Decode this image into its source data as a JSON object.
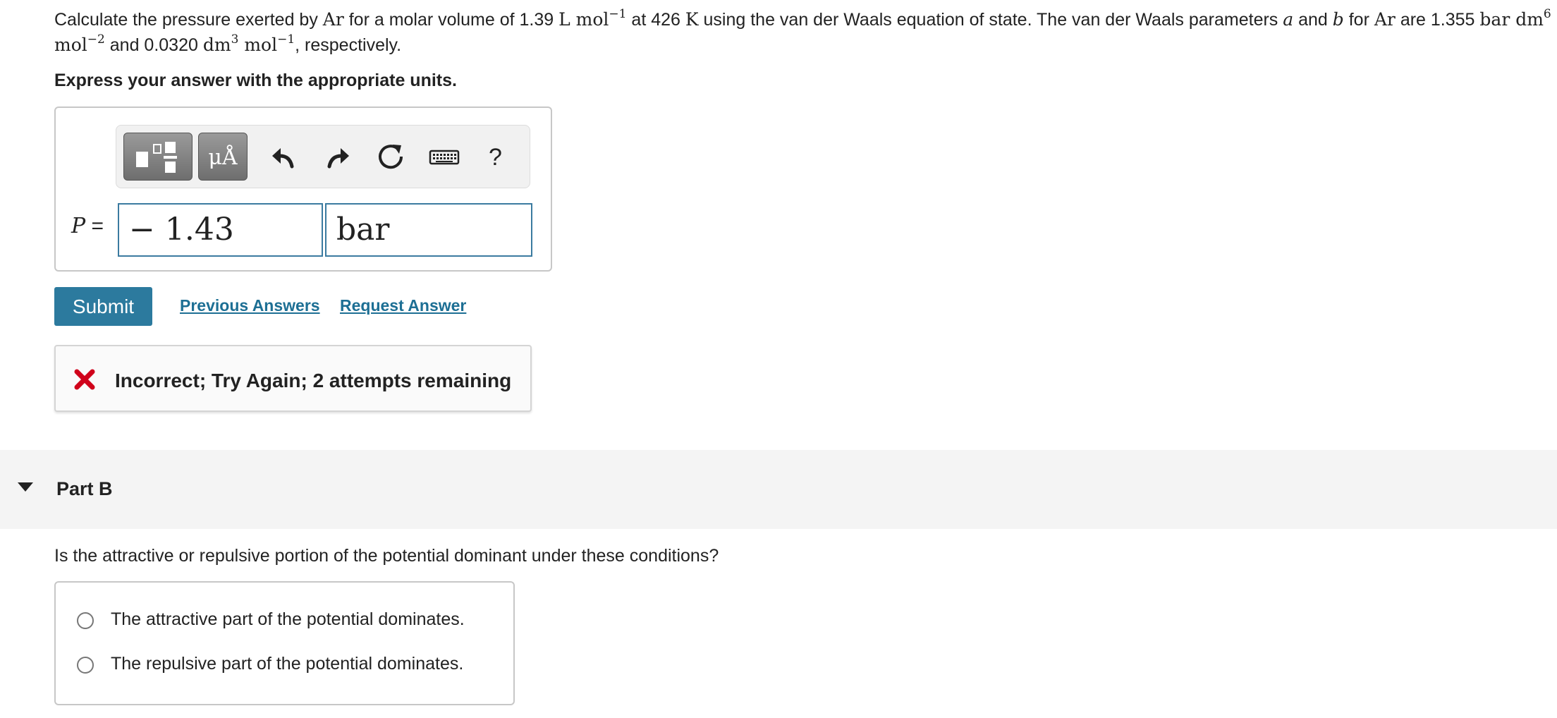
{
  "question": {
    "t1": "Calculate the pressure exerted by ",
    "gas1": "Ar",
    "t2": " for a molar volume of 1.39 ",
    "vol_unit": "L mol",
    "vol_exp": "−1",
    "t3": " at 426 ",
    "temp_unit": "K",
    "t4": " using the van der Waals equation of state. The van der Waals parameters ",
    "param_a": "a",
    "t5": " and ",
    "param_b": "b",
    "t6": " for ",
    "gas2": "Ar",
    "t7": " are 1.355 ",
    "a_unit1": "bar dm",
    "a_exp1": "6",
    "a_unit2": " mol",
    "a_exp2": "−2",
    "t8": " and 0.0320 ",
    "b_unit1": "dm",
    "b_exp1": "3",
    "b_unit2": " mol",
    "b_exp2": "−1",
    "t9": ", respectively."
  },
  "instruction": "Express your answer with the appropriate units.",
  "toolbar": {
    "units_label": "μÅ",
    "help_label": "?",
    "icons": [
      "templates-icon",
      "units-icon",
      "undo-icon",
      "redo-icon",
      "reset-icon",
      "keyboard-icon",
      "help-icon"
    ]
  },
  "answer": {
    "variable_label": "P =",
    "value": "− 1.43",
    "unit": "bar"
  },
  "actions": {
    "submit_label": "Submit",
    "previous_answers_label": "Previous Answers",
    "request_answer_label": "Request Answer"
  },
  "feedback": {
    "text": "Incorrect; Try Again; 2 attempts remaining"
  },
  "part_b": {
    "title": "Part B",
    "question": "Is the attractive or repulsive portion of the potential dominant under these conditions?",
    "options": [
      "The attractive part of the potential dominates.",
      "The repulsive part of the potential dominates."
    ]
  },
  "colors": {
    "accent": "#2c7a9e",
    "link": "#1d6f94",
    "error": "#d0021b",
    "field_border": "#3b7ba0"
  }
}
